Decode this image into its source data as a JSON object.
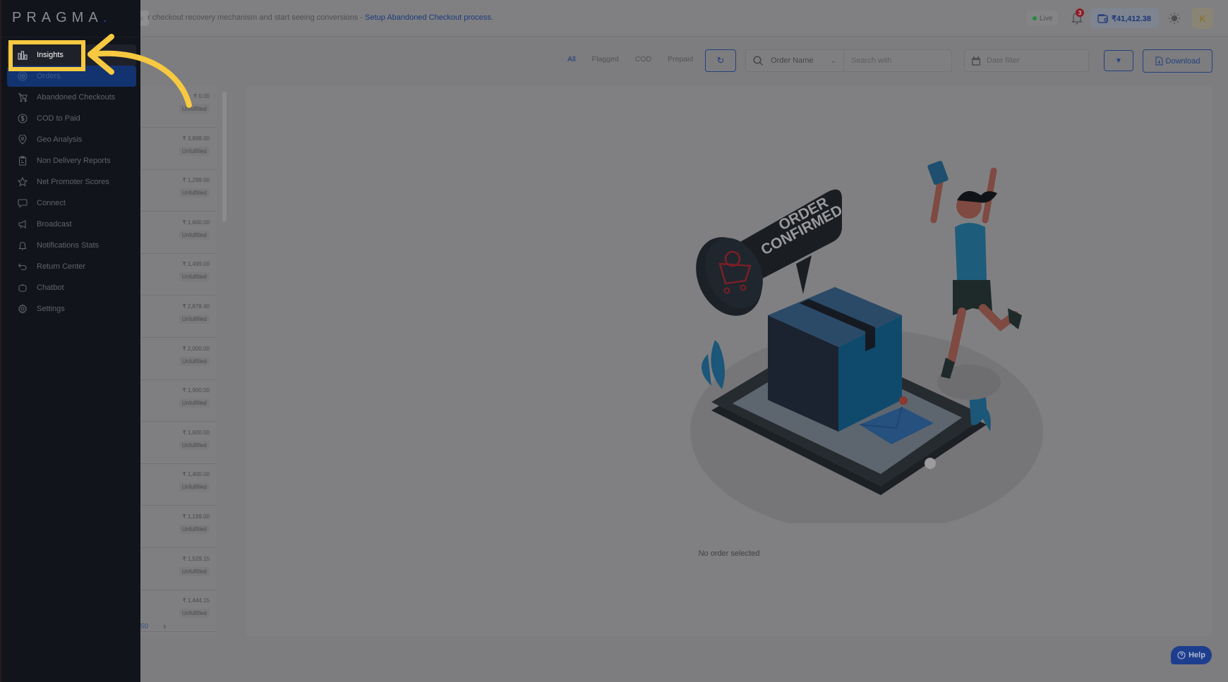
{
  "brand": {
    "name": "PRAGMA",
    "dot": "."
  },
  "sidebar": {
    "items": [
      {
        "label": "Insights",
        "icon": "bar-chart-icon",
        "state": "highlighted"
      },
      {
        "label": "Orders",
        "icon": "box-icon",
        "state": "active"
      },
      {
        "label": "Abandoned Checkouts",
        "icon": "cart-off-icon"
      },
      {
        "label": "COD to Paid",
        "icon": "dollar-circle-icon"
      },
      {
        "label": "Geo Analysis",
        "icon": "map-pin-icon"
      },
      {
        "label": "Non Delivery Reports",
        "icon": "clipboard-icon"
      },
      {
        "label": "Net Promoter Scores",
        "icon": "star-icon"
      },
      {
        "label": "Connect",
        "icon": "chat-bubble-icon"
      },
      {
        "label": "Broadcast",
        "icon": "megaphone-icon"
      },
      {
        "label": "Notifications Stats",
        "icon": "bell-icon"
      },
      {
        "label": "Return Center",
        "icon": "return-arrow-icon"
      },
      {
        "label": "Chatbot",
        "icon": "robot-icon"
      },
      {
        "label": "Settings",
        "icon": "gear-icon"
      }
    ]
  },
  "topbar": {
    "collapse_icon": "«",
    "banner_text": "r checkout recovery mechanism and start seeing conversions - ",
    "banner_link": "Setup Abandoned Checkout process.",
    "live_label": "Live",
    "notification_count": "3",
    "wallet_balance": "₹41,412.38",
    "avatar_initial": "K"
  },
  "toolbar": {
    "tabs": [
      {
        "label": "All",
        "active": true
      },
      {
        "label": "Flagged"
      },
      {
        "label": "COD"
      },
      {
        "label": "Prepaid"
      }
    ],
    "refresh_icon": "↻",
    "search_field_selected": "Order Name",
    "search_placeholder": "Search with",
    "date_placeholder": "Date filter",
    "filter_icon": "▼",
    "download_label": "Download"
  },
  "orders": [
    {
      "amount": "₹ 0.00",
      "status": "Unfulfilled"
    },
    {
      "amount": "₹ 3,898.00",
      "status": "Unfulfilled"
    },
    {
      "amount": "₹ 1,299.00",
      "status": "Unfulfilled"
    },
    {
      "amount": "₹ 1,600.00",
      "status": "Unfulfilled"
    },
    {
      "amount": "₹ 1,499.00",
      "status": "Unfulfilled"
    },
    {
      "amount": "₹ 2,878.40",
      "status": "Unfulfilled"
    },
    {
      "amount": "₹ 2,000.00",
      "status": "Unfulfilled"
    },
    {
      "amount": "₹ 1,900.00",
      "status": "Unfulfilled"
    },
    {
      "amount": "₹ 1,600.00",
      "status": "Unfulfilled"
    },
    {
      "amount": "₹ 1,400.00",
      "status": "Unfulfilled"
    },
    {
      "amount": "₹ 1,199.00",
      "status": "Unfulfilled"
    },
    {
      "amount": "₹ 1,529.15",
      "status": "Unfulfilled"
    },
    {
      "amount": "₹ 1,444.15",
      "status": "Unfulfilled"
    }
  ],
  "pager": {
    "page_size": "50",
    "next_icon": "›"
  },
  "detail": {
    "illustration_text_line1": "ORDER",
    "illustration_text_line2": "CONFIRMED",
    "empty_message": "No order selected"
  },
  "help": {
    "label": "Help"
  },
  "colors": {
    "accent": "#1d3777",
    "active_nav": "#12336f",
    "annotation": "#f7c940",
    "sidebar_bg": "#12141b"
  }
}
